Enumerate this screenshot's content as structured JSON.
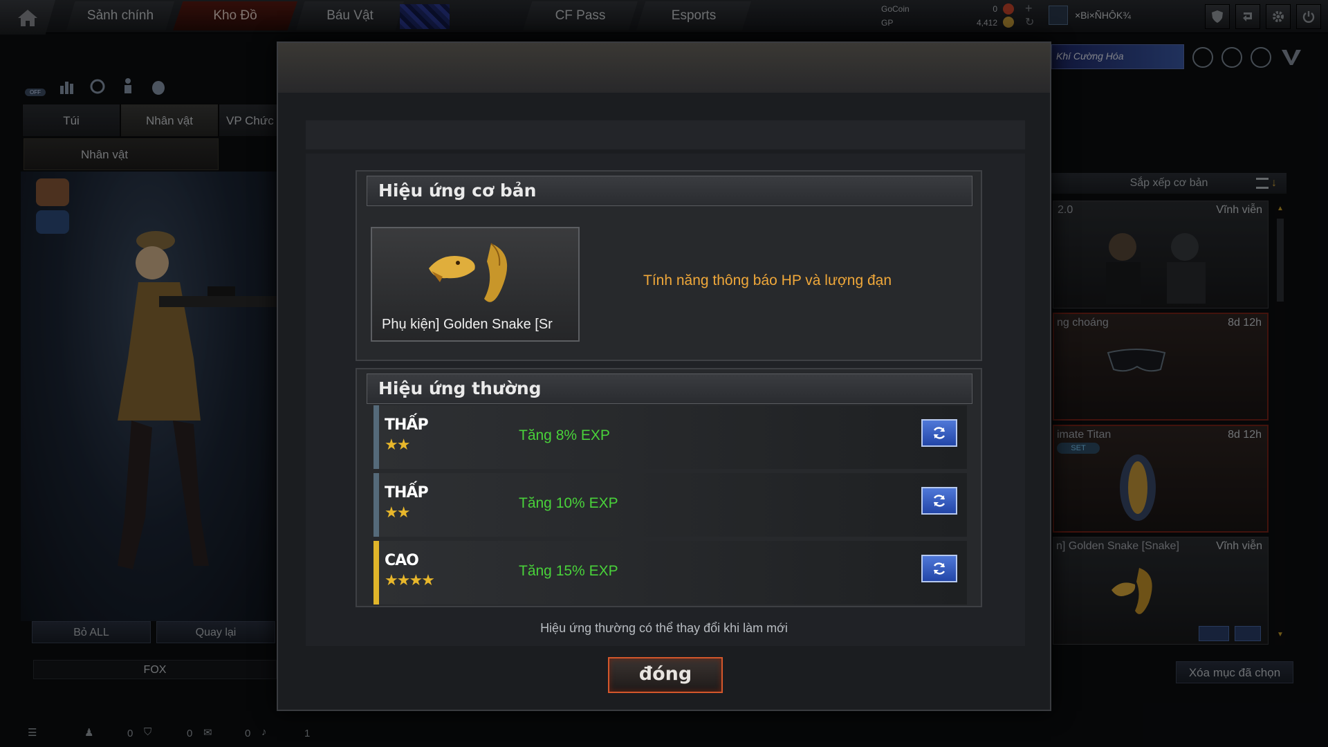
{
  "topnav": {
    "tabs": [
      "Sảnh chính",
      "Kho Đồ",
      "Báu Vật",
      "CF Pass",
      "Esports"
    ],
    "gocoin_label": "GoCoin",
    "gocoin_value": "0",
    "gp_label": "GP",
    "gp_value": "4,412",
    "username": "×Bi×ÑHÔK¾"
  },
  "left": {
    "tabs": [
      "Túi",
      "Nhân vật",
      "VP Chức"
    ],
    "subtab": "Nhân vật",
    "remove_all": "Bỏ ALL",
    "back": "Quay lại",
    "character_name": "FOX",
    "toggle_label": "OFF"
  },
  "right": {
    "banner": "Khí Cường Hóa",
    "sort_label": "Sắp xếp cơ bản",
    "cards": [
      {
        "name": "2.0",
        "time": "Vĩnh viễn"
      },
      {
        "name": "ng choáng",
        "time": "8d 12h"
      },
      {
        "name": "imate Titan",
        "time": "8d 12h",
        "badge": "SET"
      },
      {
        "name": "n] Golden Snake [Snake]",
        "time": "Vĩnh viễn"
      }
    ],
    "clear_selected": "Xóa mục đã chọn"
  },
  "statusbar": {
    "counts": [
      "0",
      "0",
      "0",
      "1"
    ]
  },
  "modal": {
    "basic_title": "Hiệu ứng cơ bản",
    "item_name": "Phụ kiện] Golden Snake [Sr",
    "basic_effect": "Tính năng thông báo HP và lượng đạn",
    "normal_title": "Hiệu ứng thường",
    "effects": [
      {
        "tier": "THẤP",
        "stars": "★★",
        "text": "Tăng 8% EXP"
      },
      {
        "tier": "THẤP",
        "stars": "★★",
        "text": "Tăng 10% EXP"
      },
      {
        "tier": "CAO",
        "stars": "★★★★",
        "text": "Tăng 15% EXP"
      }
    ],
    "note": "Hiệu ứng thường có thể thay đổi khi làm mới",
    "close": "đóng"
  }
}
